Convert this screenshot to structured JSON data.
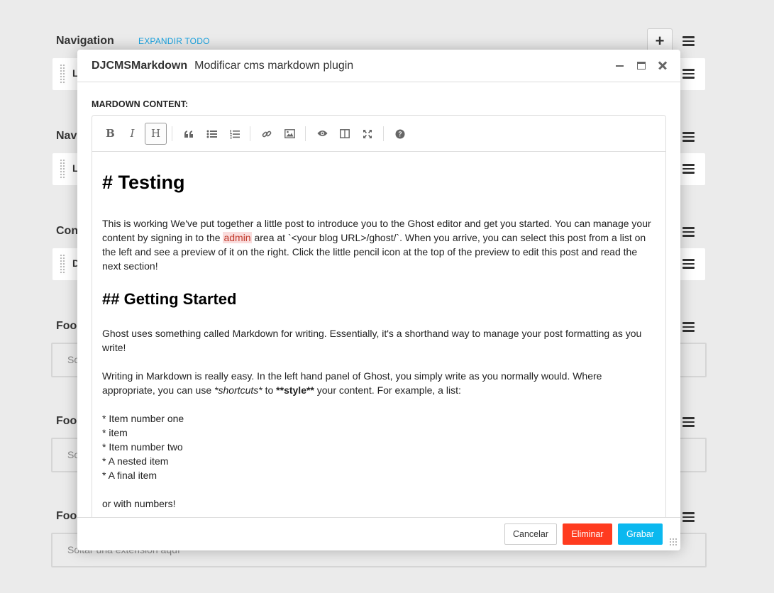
{
  "board": {
    "placeholders": [
      {
        "title": "Navigation",
        "row_initial": "L"
      },
      {
        "title": "Nav",
        "row_initial": "L"
      },
      {
        "title": "Con",
        "row_initial": "D"
      },
      {
        "title": "Foo",
        "empty_text": "Sol"
      },
      {
        "title": "Foo",
        "empty_text": "Sol"
      },
      {
        "title": "Foo",
        "empty_text": "Soltar una extensión aquí"
      }
    ],
    "expand_all_label": "EXPANDIR TODO",
    "add_label": "+"
  },
  "modal": {
    "plugin_name": "DJCMSMarkdown",
    "title": "Modificar cms markdown plugin",
    "field_label": "MARDOWN CONTENT:",
    "toolbar": {
      "bold": "B",
      "italic": "I",
      "heading": "H",
      "icons": [
        "quote-icon",
        "unordered-list-icon",
        "ordered-list-icon",
        "link-icon",
        "image-icon",
        "preview-icon",
        "side-by-side-icon",
        "fullscreen-icon",
        "help-icon"
      ]
    },
    "content": {
      "h1": "# Testing",
      "p1_before": "This is working We've put together a little post to introduce you to the Ghost editor and get you started. You can manage your content by signing in to the ",
      "p1_highlight": "admin",
      "p1_after": " area at `<your blog URL>/ghost/`. When you arrive, you can select this post from a list on the left and see a preview of it on the right. Click the little pencil icon at the top of the preview to edit this post and read the next section!",
      "h2": "## Getting Started",
      "p2": "Ghost uses something called Markdown for writing. Essentially, it's a shorthand way to manage your post formatting as you write!",
      "p3_before": "Writing in Markdown is really easy. In the left hand panel of Ghost, you simply write as you normally would. Where appropriate, you can use ",
      "p3_italic": "*shortcuts*",
      "p3_mid": " to ",
      "p3_bold": "**style**",
      "p3_after": " your content. For example, a list:",
      "list": [
        "* Item number one",
        "* item",
        "* Item number two",
        "* A nested item",
        "* A final item"
      ],
      "p4": "or with numbers!"
    },
    "buttons": {
      "cancel": "Cancelar",
      "delete": "Eliminar",
      "save": "Grabar"
    }
  }
}
